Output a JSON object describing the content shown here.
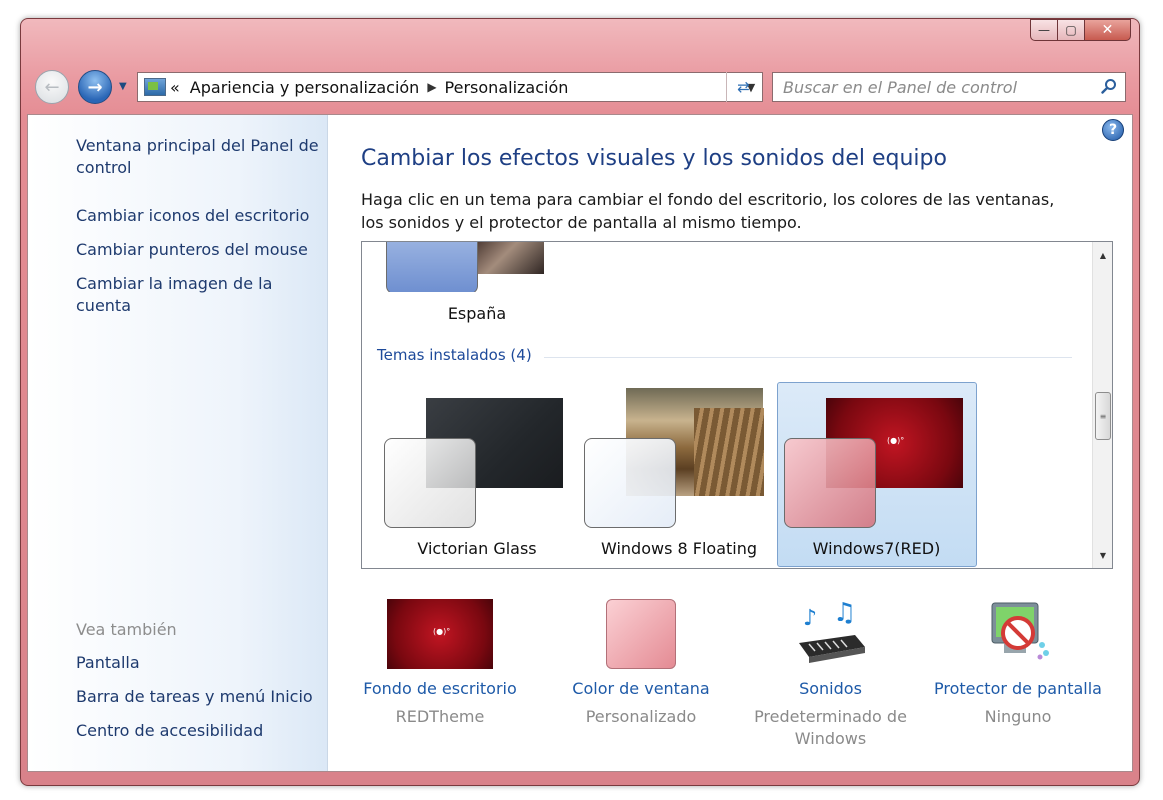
{
  "window": {
    "controls": {
      "minimize": "—",
      "maximize": "▢",
      "close": "✕"
    }
  },
  "nav": {
    "back_icon": "←",
    "forward_icon": "→",
    "history_icon": "▼"
  },
  "address": {
    "overflow": "«",
    "crumbs": [
      "Apariencia y personalización",
      "Personalización"
    ],
    "separator": "▶",
    "dropdown_icon": "▼",
    "refresh_icon": "⇄"
  },
  "search": {
    "placeholder": "Buscar en el Panel de control"
  },
  "sidebar": {
    "links": [
      "Ventana principal del Panel de control",
      "Cambiar iconos del escritorio",
      "Cambiar punteros del mouse",
      "Cambiar la imagen de la cuenta"
    ],
    "see_also_title": "Vea también",
    "see_also": [
      "Pantalla",
      "Barra de tareas y menú Inicio",
      "Centro de accesibilidad"
    ]
  },
  "main": {
    "help_icon": "?",
    "heading": "Cambiar los efectos visuales y los sonidos del equipo",
    "description": "Haga clic en un tema para cambiar el fondo del escritorio, los colores de las ventanas, los sonidos y el protector de pantalla al mismo tiempo."
  },
  "themes": {
    "top_theme": "España",
    "group_title": "Temas instalados (4)",
    "installed": [
      "Victorian Glass",
      "Windows 8 Floating",
      "Windows7(RED)"
    ],
    "selected": "Windows7(RED)"
  },
  "scroll": {
    "up": "▲",
    "down": "▼",
    "grip": "≡"
  },
  "bottom": [
    {
      "label": "Fondo de escritorio",
      "value": "REDTheme",
      "icon": "wallpaper-thumbnail"
    },
    {
      "label": "Color de ventana",
      "value": "Personalizado",
      "icon": "window-color-swatch"
    },
    {
      "label": "Sonidos",
      "value": "Predeterminado de Windows",
      "icon": "sound-keyboard-icon"
    },
    {
      "label": "Protector de pantalla",
      "value": "Ninguno",
      "icon": "screensaver-icon"
    }
  ],
  "colors": {
    "accent": "#1e5aa8",
    "frame": "#e48c93",
    "theme_red": "#9a0e16"
  }
}
